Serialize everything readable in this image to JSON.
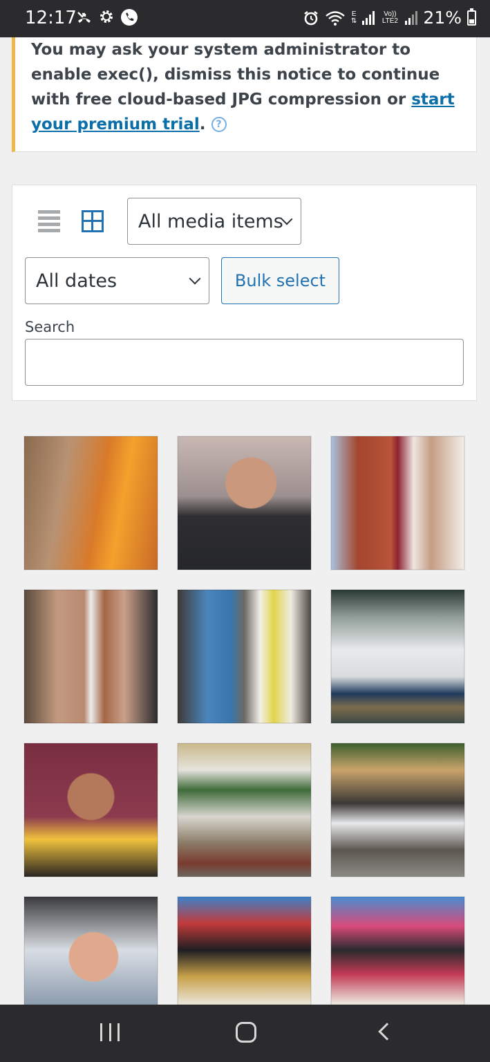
{
  "status_bar": {
    "time": "12:17",
    "battery_percent": "21%",
    "network_label": "E",
    "volte_label": "Vo)) LTE2",
    "left_icons": [
      "missed-call-icon",
      "settings-icon",
      "phone-icon"
    ],
    "right_icons": [
      "alarm-icon",
      "wifi-icon",
      "signal-icon",
      "battery-icon"
    ]
  },
  "notice": {
    "text_before_link": "You may ask your system administrator to enable exec(), dismiss this notice to continue with free cloud-based JPG compression or ",
    "link_text": "start your premium trial",
    "text_after_link": ".",
    "help_symbol": "?"
  },
  "toolbar": {
    "view_modes": [
      "list-view-icon",
      "grid-view-icon"
    ],
    "active_view": "grid",
    "type_filter": "All media items",
    "date_filter": "All dates",
    "bulk_select_label": "Bulk select",
    "search_label": "Search",
    "search_value": ""
  },
  "media_grid": {
    "columns": 3,
    "items": [
      "media-thumbnail-1",
      "media-thumbnail-2",
      "media-thumbnail-3",
      "media-thumbnail-4",
      "media-thumbnail-5",
      "media-thumbnail-6",
      "media-thumbnail-7",
      "media-thumbnail-8",
      "media-thumbnail-9",
      "media-thumbnail-10",
      "media-thumbnail-11",
      "media-thumbnail-12"
    ]
  },
  "nav_bar": {
    "buttons": [
      "recent-apps-icon",
      "home-icon",
      "back-icon"
    ]
  },
  "colors": {
    "accent": "#2271b1",
    "notice_border": "#f0b849",
    "link": "#0a6ea8",
    "system_bar": "#2b2b2d"
  }
}
